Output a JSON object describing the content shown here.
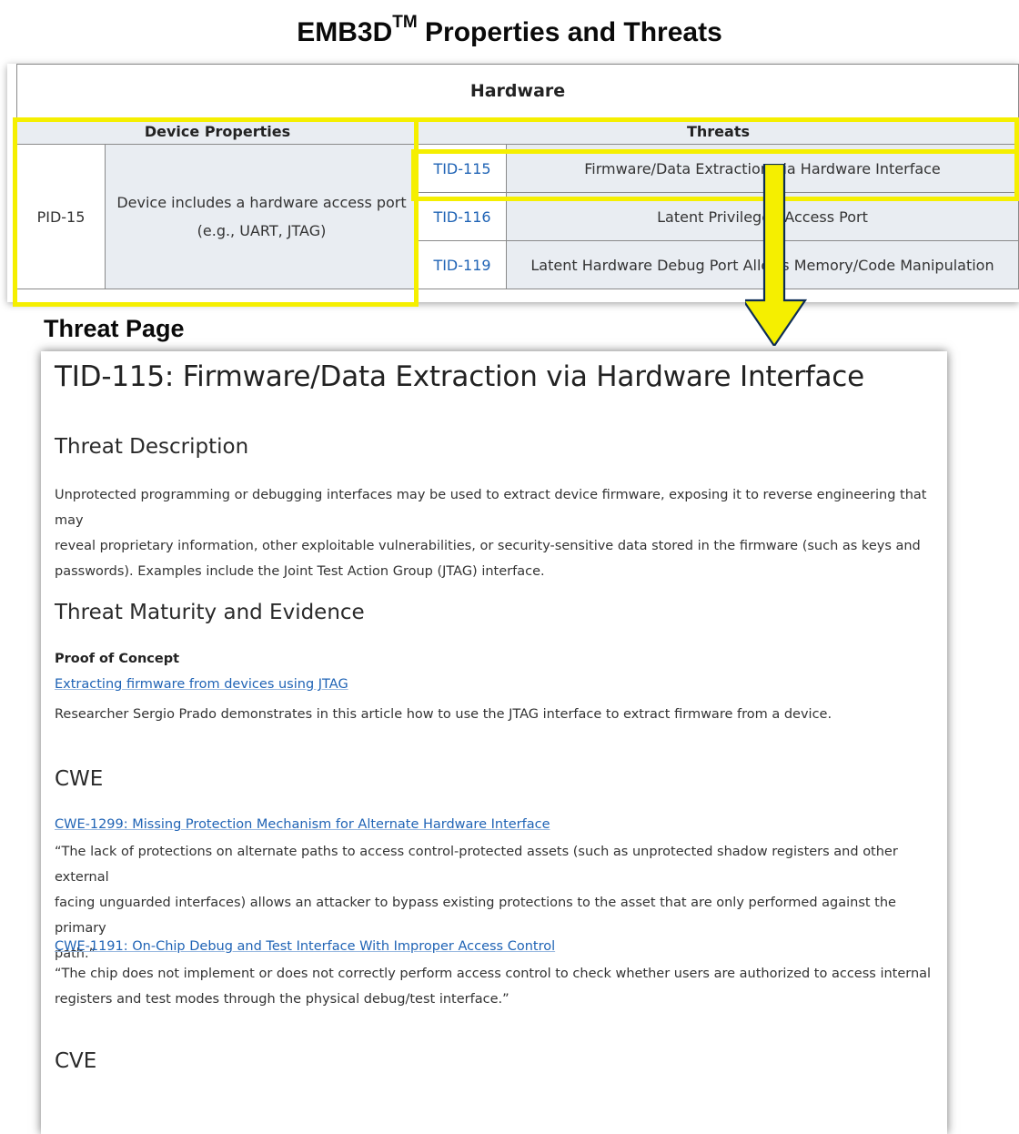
{
  "figure": {
    "title": "EMB3D",
    "title_sup": "TM",
    "title_rest": " Properties and Threats",
    "threat_page_label": "Threat Page",
    "highlight_color": "#f5ef00",
    "arrow_color": "#f5ef00"
  },
  "table": {
    "category": "Hardware",
    "headers": {
      "properties": "Device Properties",
      "threats": "Threats"
    },
    "property": {
      "id": "PID-15",
      "description_line1": "Device includes a hardware access port",
      "description_line2": "(e.g., UART, JTAG)"
    },
    "threats": [
      {
        "id": "TID-115",
        "name": "Firmware/Data Extraction via Hardware Interface"
      },
      {
        "id": "TID-116",
        "name": "Latent Privileged Access Port"
      },
      {
        "id": "TID-119",
        "name": "Latent Hardware Debug Port Allows Memory/Code Manipulation"
      }
    ]
  },
  "threat_page": {
    "title": "TID-115: Firmware/Data Extraction via Hardware Interface",
    "description_heading": "Threat Description",
    "description_lines": [
      "Unprotected programming or debugging interfaces may be used to extract device firmware, exposing it to reverse engineering that may",
      "reveal proprietary information, other exploitable vulnerabilities, or security-sensitive data stored in the firmware (such as keys and",
      "passwords). Examples include the Joint Test Action Group (JTAG) interface."
    ],
    "maturity_heading": "Threat Maturity and Evidence",
    "proof_label": "Proof of Concept",
    "proof_link": "Extracting firmware from devices using JTAG",
    "proof_text": "Researcher Sergio Prado demonstrates in this article how to use the JTAG interface to extract firmware from a device.",
    "cwe_heading": "CWE",
    "cwe": [
      {
        "link": "CWE-1299: Missing Protection Mechanism for Alternate Hardware Interface",
        "lines": [
          "“The lack of protections on alternate paths to access control-protected assets (such as unprotected shadow registers and other external",
          "facing unguarded interfaces) allows an attacker to bypass existing protections to the asset that are only performed against the primary",
          "path.”"
        ]
      },
      {
        "link": "CWE-1191: On-Chip Debug and Test Interface With Improper Access Control",
        "lines": [
          "“The chip does not implement or does not correctly perform access control to check whether users are authorized to access internal",
          "registers and test modes through the physical debug/test interface.”"
        ]
      }
    ],
    "cve_heading": "CVE"
  }
}
